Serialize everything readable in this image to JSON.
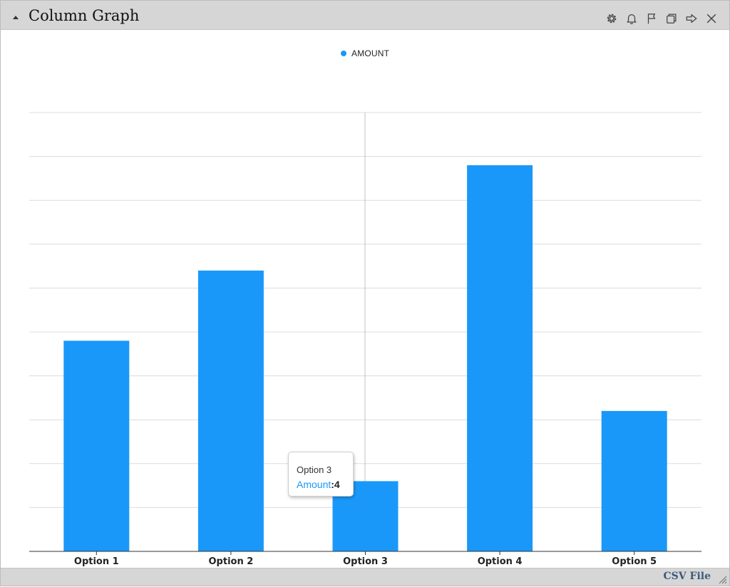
{
  "window": {
    "title": "Column Graph",
    "toolbar_icons": [
      "gear-icon",
      "bell-icon",
      "flag-icon",
      "copy-icon",
      "arrow-right-icon",
      "close-icon"
    ]
  },
  "legend": {
    "label": "AMOUNT",
    "color": "#1a98f9"
  },
  "tooltip": {
    "title": "Option 3",
    "series": "Amount",
    "separator": ":",
    "value": "4"
  },
  "footer": {
    "csv_label": "CSV File"
  },
  "colors": {
    "accent": "#1a98f9",
    "titlebar": "#d6d6d6"
  },
  "chart_data": {
    "type": "bar",
    "categories": [
      "Option 1",
      "Option 2",
      "Option 3",
      "Option 4",
      "Option 5"
    ],
    "series": [
      {
        "name": "AMOUNT",
        "values": [
          12,
          16,
          4,
          22,
          8
        ]
      }
    ],
    "ylim": [
      0,
      25
    ],
    "grid": true,
    "legend_position": "top-center",
    "title": "",
    "xlabel": "",
    "ylabel": ""
  }
}
